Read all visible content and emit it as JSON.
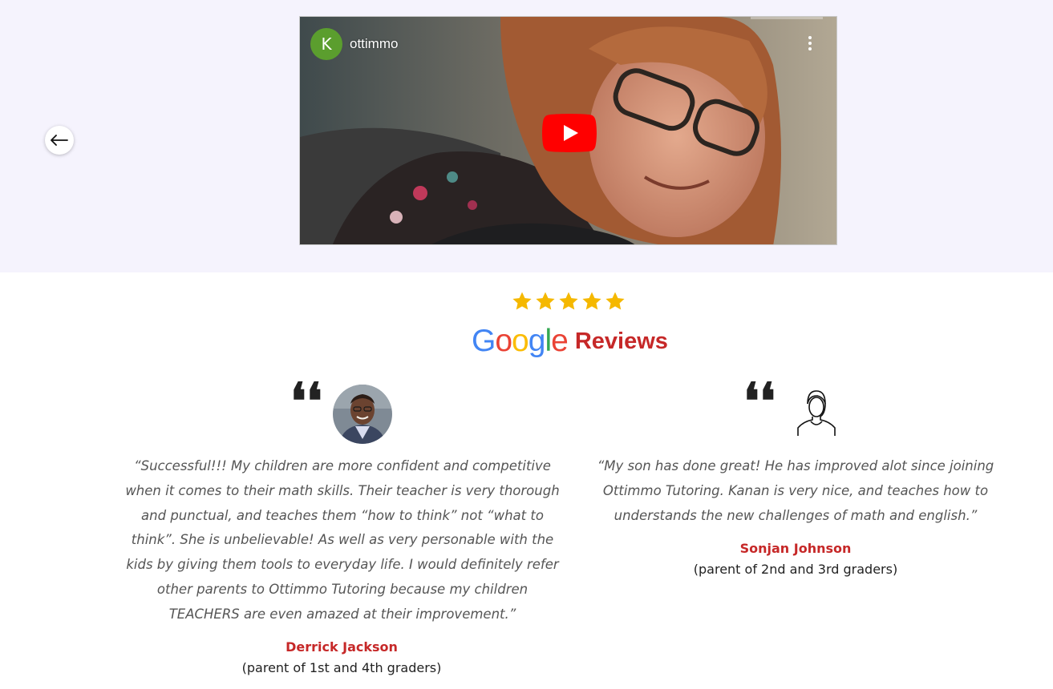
{
  "video": {
    "channel_initial": "K",
    "channel_name": "ottimmo",
    "menu_icon": "more-vertical-icon",
    "play_icon": "youtube-play-icon"
  },
  "carousel": {
    "prev_icon": "arrow-left-icon"
  },
  "rating": {
    "stars": 5,
    "star_color": "#f5b800"
  },
  "reviews_header": {
    "google_letters": [
      "G",
      "o",
      "o",
      "g",
      "l",
      "e"
    ],
    "google_colors": [
      "#4285F4",
      "#EA4335",
      "#FBBC05",
      "#4285F4",
      "#34A853",
      "#EA4335"
    ],
    "reviews_label": "Reviews",
    "accent_color": "#c62828"
  },
  "reviews": [
    {
      "quote_symbol": "❛❛",
      "text": "“Successful!!! My children are more confident and competitive when it comes to their math skills. Their teacher is very thorough and punctual, and teaches them “how to think” not “what to think”. She is unbelievable! As well as very personable with the kids by giving them tools to everyday life. I would definitely refer other parents to Ottimmo Tutoring because my children TEACHERS are even amazed at their improvement.”",
      "name": "Derrick Jackson",
      "role": "(parent of 1st and 4th graders)"
    },
    {
      "quote_symbol": "❛❛",
      "text": "“My son has done great! He has improved alot since joining Ottimmo Tutoring. Kanan is very nice, and teaches how to understands the new challenges of math and english.”",
      "name": "Sonjan Johnson",
      "role": "(parent of 2nd and 3rd graders)"
    }
  ]
}
